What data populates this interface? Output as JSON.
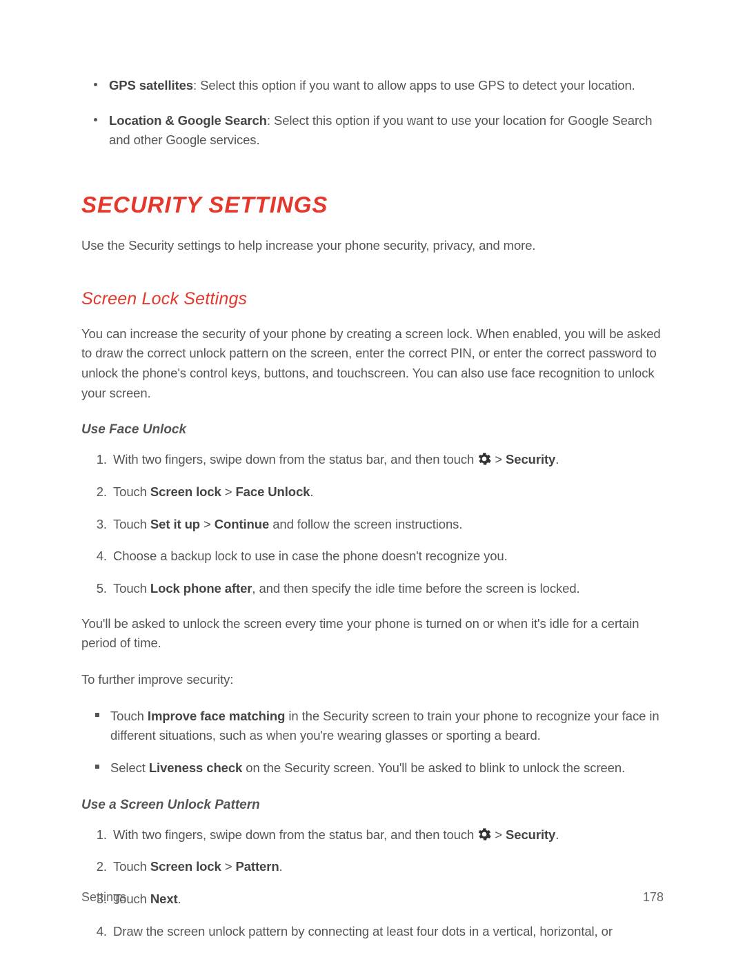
{
  "topBullets": [
    {
      "bold": "GPS satellites",
      "rest": ": Select this option if you want to allow apps to use GPS to detect your location."
    },
    {
      "bold": "Location & Google Search",
      "rest": ": Select this option if you want to use your location for Google Search and other Google services."
    }
  ],
  "sectionTitle": "SECURITY SETTINGS",
  "sectionIntro": "Use the Security settings to help increase your phone security, privacy, and more.",
  "screenLock": {
    "title": "Screen Lock Settings",
    "intro": "You can increase the security of your phone by creating a screen lock. When enabled, you will be asked to draw the correct unlock pattern on the screen, enter the correct PIN, or enter the correct password to unlock the phone's control keys, buttons, and touchscreen. You can also use face recognition to unlock your screen."
  },
  "faceUnlock": {
    "title": "Use Face Unlock",
    "step1_a": "With two fingers, swipe down from the status bar, and then touch ",
    "step1_b": " > ",
    "step1_c": "Security",
    "step1_d": ".",
    "step2_a": "Touch ",
    "step2_b": "Screen lock",
    "step2_c": "  > ",
    "step2_d": "Face Unlock",
    "step2_e": ".",
    "step3_a": "Touch ",
    "step3_b": "Set it up",
    "step3_c": " > ",
    "step3_d": "Continue",
    "step3_e": " and follow the screen instructions.",
    "step4": "Choose a backup lock to use in case the phone doesn't recognize you.",
    "step5_a": "Touch ",
    "step5_b": "Lock phone after",
    "step5_c": ", and then specify the idle time before the screen is locked.",
    "after": "You'll be asked to unlock the screen every time your phone is turned on or when it's idle for a certain period of time.",
    "improveIntro": "To further improve security:",
    "improve1_a": "Touch ",
    "improve1_b": "Improve face matching",
    "improve1_c": " in the Security screen to train your phone to recognize your face in different situations, such as when you're wearing glasses or sporting a beard.",
    "improve2_a": "Select ",
    "improve2_b": "Liveness check",
    "improve2_c": " on the Security screen. You'll be asked to blink to unlock the screen."
  },
  "pattern": {
    "title": "Use a Screen Unlock Pattern",
    "step1_a": "With two fingers, swipe down from the status bar, and then touch ",
    "step1_b": " > ",
    "step1_c": "Security",
    "step1_d": ".",
    "step2_a": "Touch ",
    "step2_b": "Screen lock",
    "step2_c": " > ",
    "step2_d": "Pattern",
    "step2_e": ".",
    "step3_a": "Touch ",
    "step3_b": "Next",
    "step3_c": ".",
    "step4": "Draw the screen unlock pattern by connecting at least four dots in a vertical, horizontal, or"
  },
  "footer": {
    "left": "Settings",
    "right": "178"
  }
}
